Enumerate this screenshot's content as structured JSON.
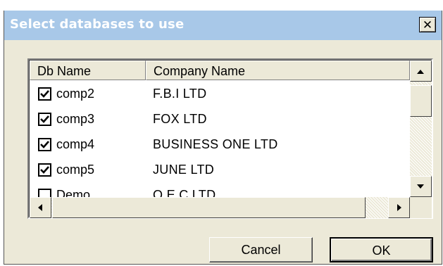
{
  "window": {
    "title": "Select databases to use",
    "close_glyph": "✕"
  },
  "list": {
    "columns": [
      "Db Name",
      "Company Name"
    ],
    "rows": [
      {
        "checked": true,
        "db_name": "comp2",
        "company": "F.B.I LTD"
      },
      {
        "checked": true,
        "db_name": "comp3",
        "company": "FOX LTD"
      },
      {
        "checked": true,
        "db_name": "comp4",
        "company": "BUSINESS ONE LTD"
      },
      {
        "checked": true,
        "db_name": "comp5",
        "company": "JUNE LTD"
      },
      {
        "checked": false,
        "db_name": "Demo",
        "company": "O.E.C LTD"
      }
    ]
  },
  "buttons": {
    "cancel": "Cancel",
    "ok": "OK"
  }
}
